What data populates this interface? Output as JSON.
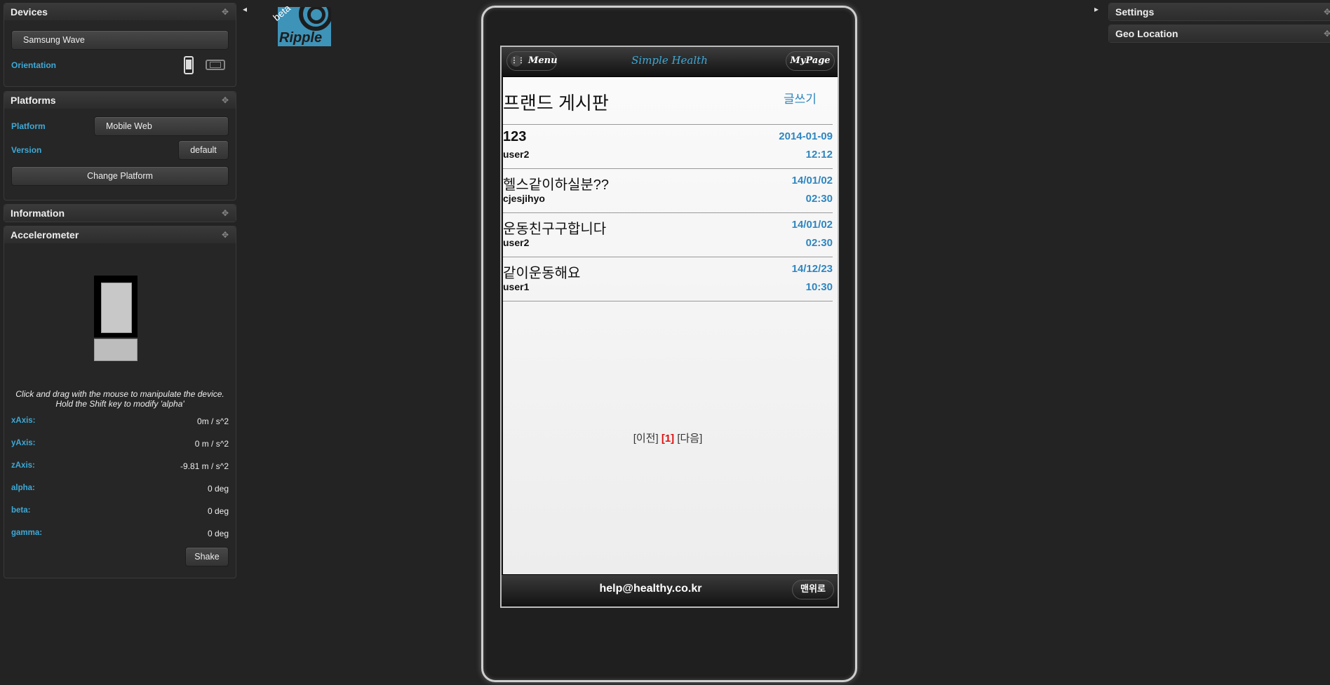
{
  "left": {
    "devices": {
      "title": "Devices",
      "device_name": "Samsung Wave",
      "orientation_label": "Orientation"
    },
    "platforms": {
      "title": "Platforms",
      "platform_label": "Platform",
      "platform_value": "Mobile Web",
      "version_label": "Version",
      "version_value": "default",
      "change_button": "Change Platform"
    },
    "information": {
      "title": "Information"
    },
    "accelerometer": {
      "title": "Accelerometer",
      "hint": "Click and drag with the mouse to manipulate the device. Hold the Shift key to modify 'alpha'",
      "rows": [
        {
          "label": "xAxis:",
          "value": "0m / s^2"
        },
        {
          "label": "yAxis:",
          "value": "0 m / s^2"
        },
        {
          "label": "zAxis:",
          "value": "-9.81 m / s^2"
        },
        {
          "label": "alpha:",
          "value": "0 deg"
        },
        {
          "label": "beta:",
          "value": "0 deg"
        },
        {
          "label": "gamma:",
          "value": "0 deg"
        }
      ],
      "shake_button": "Shake"
    }
  },
  "logo": {
    "text": "Ripple",
    "badge": "beta"
  },
  "right": {
    "settings_title": "Settings",
    "geo_title": "Geo Location"
  },
  "app": {
    "menu_label": "Menu",
    "title": "Simple Health",
    "mypage_label": "MyPage",
    "board_title": "프랜드 게시판",
    "write_label": "글쓰기",
    "posts": [
      {
        "title": "123",
        "author": "user2",
        "date": "2014-01-09",
        "time": "12:12"
      },
      {
        "title": "헬스같이하실분??",
        "author": "cjesjihyo",
        "date": "14/01/02",
        "time": "02:30"
      },
      {
        "title": "운동친구구합니다",
        "author": "user2",
        "date": "14/01/02",
        "time": "02:30"
      },
      {
        "title": "같이운동해요",
        "author": "user1",
        "date": "14/12/23",
        "time": "10:30"
      }
    ],
    "pagination": {
      "prev": "[이전]",
      "current": "[1]",
      "next": "[다음]"
    },
    "footer_email": "help@healthy.co.kr",
    "top_button": "맨위로"
  },
  "colors": {
    "accent": "#3ea9d6",
    "date": "#2e86c1",
    "page_current": "#d11"
  }
}
